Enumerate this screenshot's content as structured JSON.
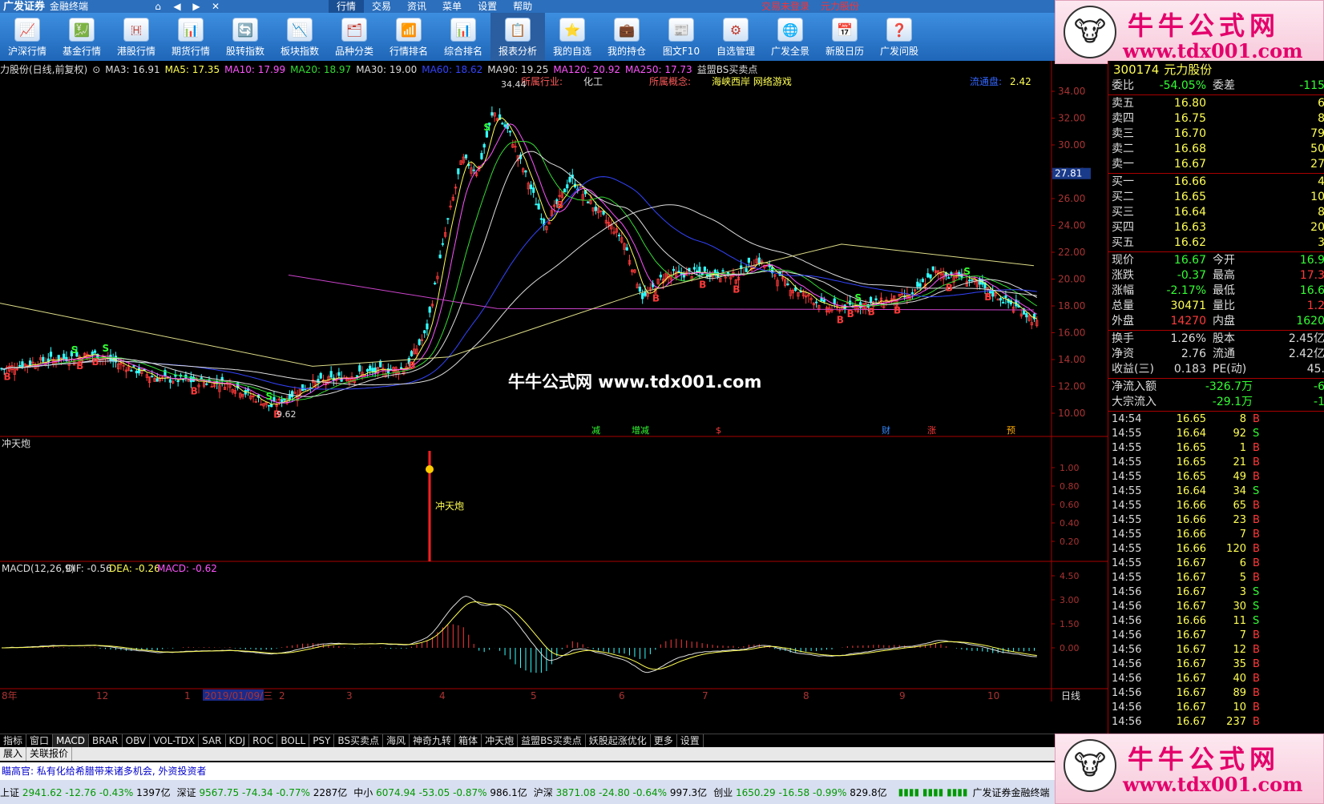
{
  "titlebar": {
    "app_name": "广发证券",
    "app_sub": "金融终端",
    "menu": [
      "行情",
      "交易",
      "资讯",
      "菜单",
      "设置",
      "帮助"
    ],
    "menu_active": 0,
    "status_right": [
      "交易未登录",
      "元力股份"
    ]
  },
  "toolbar": [
    {
      "label": "沪深行情",
      "icon": "shanghai-shenzhen-icon"
    },
    {
      "label": "基金行情",
      "icon": "fund-icon"
    },
    {
      "label": "港股行情",
      "icon": "hk-stock-icon"
    },
    {
      "label": "期货行情",
      "icon": "futures-icon"
    },
    {
      "label": "股转指数",
      "icon": "transfer-index-icon"
    },
    {
      "label": "板块指数",
      "icon": "sector-index-icon"
    },
    {
      "label": "品种分类",
      "icon": "category-icon"
    },
    {
      "label": "行情排名",
      "icon": "ranking-icon"
    },
    {
      "label": "综合排名",
      "icon": "overall-ranking-icon"
    },
    {
      "label": "报表分析",
      "icon": "report-icon"
    },
    {
      "label": "我的自选",
      "icon": "watchlist-icon"
    },
    {
      "label": "我的持仓",
      "icon": "holdings-icon"
    },
    {
      "label": "图文F10",
      "icon": "f10-icon"
    },
    {
      "label": "自选管理",
      "icon": "watchlist-manage-icon"
    },
    {
      "label": "广发全景",
      "icon": "panorama-icon"
    },
    {
      "label": "新股日历",
      "icon": "ipo-calendar-icon"
    },
    {
      "label": "广发问股",
      "icon": "ask-stock-icon"
    }
  ],
  "toolbar_active": 9,
  "watermark": {
    "top": "牛牛公式网",
    "url": "www.tdx001.com",
    "center": "牛牛公式网 www.tdx001.com"
  },
  "ma_line": {
    "name": "力股份(日线,前复权)",
    "items": [
      {
        "label": "MA3: 16.91",
        "color": "#dddddd"
      },
      {
        "label": "MA5: 17.35",
        "color": "#ffff54"
      },
      {
        "label": "MA10: 17.99",
        "color": "#ff54ff"
      },
      {
        "label": "MA20: 18.97",
        "color": "#33dd33"
      },
      {
        "label": "MA30: 19.00",
        "color": "#dddddd"
      },
      {
        "label": "MA60: 18.62",
        "color": "#3344ff"
      },
      {
        "label": "MA90: 19.25",
        "color": "#dddddd"
      },
      {
        "label": "MA120: 20.92",
        "color": "#ff54ff"
      },
      {
        "label": "MA250: 17.73",
        "color": "#ff54ff"
      },
      {
        "label": "益盟BS买卖点",
        "color": "#dddddd"
      }
    ]
  },
  "industry": {
    "label": "所属行业:",
    "value": "化工",
    "concept_label": "所属概念:",
    "concept_value": "海峡西岸 网络游戏",
    "float_label": "流通盘:",
    "float_value": "2.42"
  },
  "price_axis": [
    "34.00",
    "32.00",
    "30.00",
    "28.00",
    "26.00",
    "24.00",
    "22.00",
    "20.00",
    "18.00",
    "16.00",
    "14.00",
    "12.00",
    "10.00"
  ],
  "price_marker": "27.81",
  "annotations": {
    "high": "34.44",
    "low": "9.62"
  },
  "event_labels": [
    {
      "text": "减",
      "color": "#33ff33"
    },
    {
      "text": "增减",
      "color": "#33ff33"
    },
    {
      "text": "$",
      "color": "#ff3a3a"
    },
    {
      "text": "财",
      "color": "#3388ff"
    },
    {
      "text": "涨",
      "color": "#ff3a3a"
    },
    {
      "text": "预",
      "color": "#ffaa00"
    }
  ],
  "indicator1": {
    "name": "冲天炮",
    "signal_label": "冲天炮",
    "axis": [
      "1.00",
      "0.80",
      "0.60",
      "0.40",
      "0.20"
    ]
  },
  "macd": {
    "title": "MACD(12,26,9)",
    "dif": "DIF: -0.56",
    "dea": "DEA: -0.26",
    "macd": "MACD: -0.62",
    "axis": [
      "4.50",
      "3.00",
      "1.50",
      "0.00"
    ]
  },
  "time_axis": {
    "labels": [
      "8年",
      "12",
      "1",
      "2019/01/09/三",
      "2",
      "3",
      "4",
      "5",
      "6",
      "7",
      "8",
      "9",
      "10"
    ],
    "period": "日线"
  },
  "quote": {
    "code": "300174",
    "name": "元力股份",
    "weibi_label": "委比",
    "weibi_value": "-54.05%",
    "weicha_label": "委差",
    "weicha_value": "-115",
    "asks": [
      {
        "label": "卖五",
        "price": "16.80",
        "vol": "6"
      },
      {
        "label": "卖四",
        "price": "16.75",
        "vol": "8"
      },
      {
        "label": "卖三",
        "price": "16.70",
        "vol": "79"
      },
      {
        "label": "卖二",
        "price": "16.68",
        "vol": "50"
      },
      {
        "label": "卖一",
        "price": "16.67",
        "vol": "27"
      }
    ],
    "bids": [
      {
        "label": "买一",
        "price": "16.66",
        "vol": "4"
      },
      {
        "label": "买二",
        "price": "16.65",
        "vol": "10"
      },
      {
        "label": "买三",
        "price": "16.64",
        "vol": "8"
      },
      {
        "label": "买四",
        "price": "16.63",
        "vol": "20"
      },
      {
        "label": "买五",
        "price": "16.62",
        "vol": "3"
      }
    ],
    "stats": [
      {
        "l1": "现价",
        "v1": "16.67",
        "c1": "green",
        "l2": "今开",
        "v2": "16.9",
        "c2": "green"
      },
      {
        "l1": "涨跌",
        "v1": "-0.37",
        "c1": "green",
        "l2": "最高",
        "v2": "17.3",
        "c2": "red"
      },
      {
        "l1": "涨幅",
        "v1": "-2.17%",
        "c1": "green",
        "l2": "最低",
        "v2": "16.6",
        "c2": "green"
      },
      {
        "l1": "总量",
        "v1": "30471",
        "c1": "yellow",
        "l2": "量比",
        "v2": "1.2",
        "c2": "red"
      },
      {
        "l1": "外盘",
        "v1": "14270",
        "c1": "red",
        "l2": "内盘",
        "v2": "1620",
        "c2": "green"
      }
    ],
    "stats2": [
      {
        "l1": "换手",
        "v1": "1.26%",
        "c1": "white",
        "l2": "股本",
        "v2": "2.45亿",
        "c2": "white"
      },
      {
        "l1": "净资",
        "v1": "2.76",
        "c1": "white",
        "l2": "流通",
        "v2": "2.42亿",
        "c2": "white"
      },
      {
        "l1": "收益(三)",
        "v1": "0.183",
        "c1": "white",
        "l2": "PE(动)",
        "v2": "45.",
        "c2": "white"
      }
    ],
    "flows": [
      {
        "label": "净流入额",
        "value": "-326.7万",
        "extra": "-6"
      },
      {
        "label": "大宗流入",
        "value": "-29.1万",
        "extra": "-1"
      }
    ],
    "ticks": [
      {
        "t": "14:54",
        "p": "16.65",
        "v": "8",
        "s": "B"
      },
      {
        "t": "14:55",
        "p": "16.64",
        "v": "92",
        "s": "S"
      },
      {
        "t": "14:55",
        "p": "16.65",
        "v": "1",
        "s": "B"
      },
      {
        "t": "14:55",
        "p": "16.65",
        "v": "21",
        "s": "B"
      },
      {
        "t": "14:55",
        "p": "16.65",
        "v": "49",
        "s": "B"
      },
      {
        "t": "14:55",
        "p": "16.64",
        "v": "34",
        "s": "S"
      },
      {
        "t": "14:55",
        "p": "16.66",
        "v": "65",
        "s": "B"
      },
      {
        "t": "14:55",
        "p": "16.66",
        "v": "23",
        "s": "B"
      },
      {
        "t": "14:55",
        "p": "16.66",
        "v": "7",
        "s": "B"
      },
      {
        "t": "14:55",
        "p": "16.66",
        "v": "120",
        "s": "B"
      },
      {
        "t": "14:55",
        "p": "16.67",
        "v": "6",
        "s": "B"
      },
      {
        "t": "14:55",
        "p": "16.67",
        "v": "5",
        "s": "B"
      },
      {
        "t": "14:56",
        "p": "16.67",
        "v": "3",
        "s": "S"
      },
      {
        "t": "14:56",
        "p": "16.67",
        "v": "30",
        "s": "S"
      },
      {
        "t": "14:56",
        "p": "16.66",
        "v": "11",
        "s": "S"
      },
      {
        "t": "14:56",
        "p": "16.67",
        "v": "7",
        "s": "B"
      },
      {
        "t": "14:56",
        "p": "16.67",
        "v": "12",
        "s": "B"
      },
      {
        "t": "14:56",
        "p": "16.67",
        "v": "35",
        "s": "B"
      },
      {
        "t": "14:56",
        "p": "16.67",
        "v": "40",
        "s": "B"
      },
      {
        "t": "14:56",
        "p": "16.67",
        "v": "89",
        "s": "B"
      },
      {
        "t": "14:56",
        "p": "16.67",
        "v": "10",
        "s": "B"
      },
      {
        "t": "14:56",
        "p": "16.67",
        "v": "237",
        "s": "B"
      }
    ]
  },
  "tabs": [
    "指标",
    "窗口",
    "MACD",
    "BRAR",
    "OBV",
    "VOL-TDX",
    "SAR",
    "KDJ",
    "ROC",
    "BOLL",
    "PSY",
    "BS买卖点",
    "海风",
    "神奇九转",
    "箱体",
    "冲天炮",
    "益盟BS买卖点",
    "妖股起涨优化",
    "更多",
    "设置"
  ],
  "tabs_active": 2,
  "bar2": [
    "展入",
    "关联报价"
  ],
  "ticker": "瞄高官: 私有化给希腊带来诸多机会, 外资投资者",
  "indices": [
    {
      "name": "上证",
      "value": "2941.62",
      "chg": "-12.76",
      "pct": "-0.43%",
      "amt": "1397亿"
    },
    {
      "name": "深证",
      "value": "9567.75",
      "chg": "-74.34",
      "pct": "-0.77%",
      "amt": "2287亿"
    },
    {
      "name": "中小",
      "value": "6074.94",
      "chg": "-53.05",
      "pct": "-0.87%",
      "amt": "986.1亿"
    },
    {
      "name": "沪深",
      "value": "3871.08",
      "chg": "-24.80",
      "pct": "-0.64%",
      "amt": "997.3亿"
    },
    {
      "name": "创业",
      "value": "1650.29",
      "chg": "-16.58",
      "pct": "-0.99%",
      "amt": "829.8亿"
    }
  ],
  "broker": "广发证券金融终端",
  "colors": {
    "up": "#ff3a3a",
    "down": "#33ffff",
    "axis": "#aa0000",
    "text": "#dddddd"
  }
}
